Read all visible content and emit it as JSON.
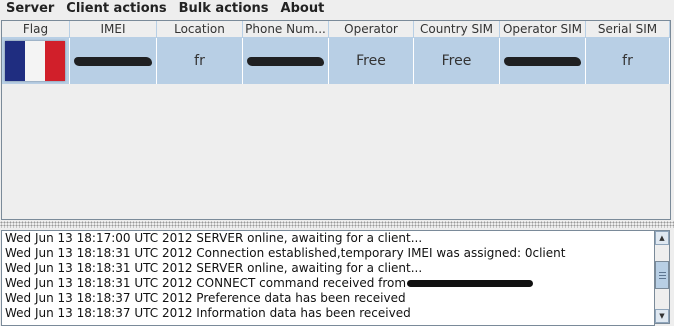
{
  "menu": {
    "server": "Server",
    "client_actions": "Client actions",
    "bulk_actions": "Bulk actions",
    "about": "About"
  },
  "table": {
    "columns": [
      "Flag",
      "IMEI",
      "Location",
      "Phone Num...",
      "Operator",
      "Country SIM",
      "Operator SIM",
      "Serial SIM"
    ],
    "rows": [
      {
        "flag_icon": "france-flag-icon",
        "imei": "",
        "location": "fr",
        "phone_number": "",
        "operator": "Free",
        "country_sim": "Free",
        "operator_sim": "",
        "serial_sim": "fr"
      }
    ]
  },
  "log": {
    "lines": [
      "Wed Jun 13 18:17:00 UTC 2012 SERVER online, awaiting for a client...",
      "Wed Jun 13 18:18:31 UTC 2012 Connection established,temporary IMEI was assigned: 0client",
      "Wed Jun 13 18:18:31 UTC 2012 SERVER online, awaiting for a client...",
      "Wed Jun 13 18:18:31 UTC 2012 CONNECT command received from",
      "Wed Jun 13 18:18:37 UTC 2012 Preference data has been received",
      "Wed Jun 13 18:18:37 UTC 2012 Information data has been received"
    ]
  },
  "colors": {
    "selection": "#b8cfe5",
    "background": "#eeeeee",
    "flag_blue": "#1f2d80",
    "flag_red": "#d11f2a"
  },
  "icons": {
    "scroll_up": "arrow-up-icon",
    "scroll_down": "arrow-down-icon"
  }
}
